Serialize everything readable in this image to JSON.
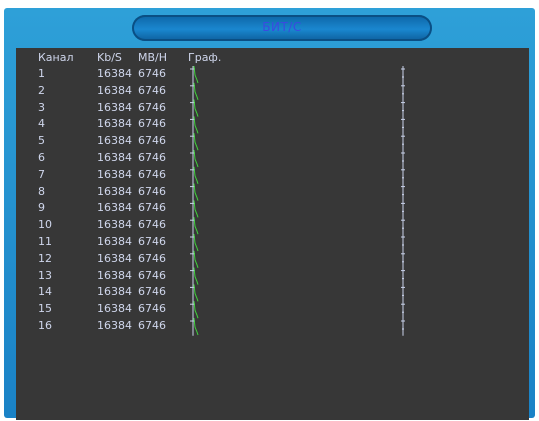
{
  "window": {
    "title": "БИТ/С"
  },
  "table": {
    "headers": {
      "channel": "Канал",
      "kbs": "Kb/S",
      "mbh": "MB/H",
      "graph": "Граф."
    },
    "rows": [
      {
        "channel": "1",
        "kbs": "16384",
        "mbh": "6746"
      },
      {
        "channel": "2",
        "kbs": "16384",
        "mbh": "6746"
      },
      {
        "channel": "3",
        "kbs": "16384",
        "mbh": "6746"
      },
      {
        "channel": "4",
        "kbs": "16384",
        "mbh": "6746"
      },
      {
        "channel": "5",
        "kbs": "16384",
        "mbh": "6746"
      },
      {
        "channel": "6",
        "kbs": "16384",
        "mbh": "6746"
      },
      {
        "channel": "7",
        "kbs": "16384",
        "mbh": "6746"
      },
      {
        "channel": "8",
        "kbs": "16384",
        "mbh": "6746"
      },
      {
        "channel": "9",
        "kbs": "16384",
        "mbh": "6746"
      },
      {
        "channel": "10",
        "kbs": "16384",
        "mbh": "6746"
      },
      {
        "channel": "11",
        "kbs": "16384",
        "mbh": "6746"
      },
      {
        "channel": "12",
        "kbs": "16384",
        "mbh": "6746"
      },
      {
        "channel": "13",
        "kbs": "16384",
        "mbh": "6746"
      },
      {
        "channel": "14",
        "kbs": "16384",
        "mbh": "6746"
      },
      {
        "channel": "15",
        "kbs": "16384",
        "mbh": "6746"
      },
      {
        "channel": "16",
        "kbs": "16384",
        "mbh": "6746"
      }
    ]
  },
  "colors": {
    "window_blue": "#1a87cf",
    "title_text": "#3a4be0",
    "panel_bg": "#373737",
    "text": "#cfd6ec",
    "graph_line": "#3fd23a",
    "graph_axis": "#c9d2ea"
  }
}
